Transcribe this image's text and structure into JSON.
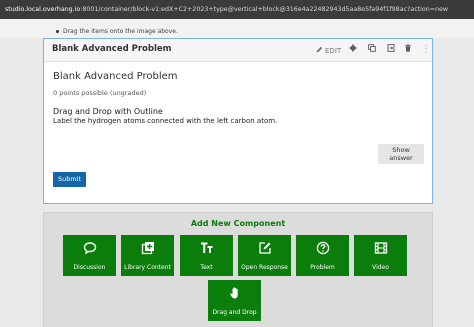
{
  "browser": {
    "url_host": "studio.local.overhang.io",
    "url_rest": ":8001/container/block-v1:edX+C2+2023+type@vertical+block@316e4a22482943d5aa8e5fa94f1f98ac?action=new"
  },
  "above_content": {
    "partial_text": "Drag the items onto the image above."
  },
  "xblock": {
    "header_title": "Blank Advanced Problem",
    "edit_label": "EDIT",
    "problem_title": "Blank Advanced Problem",
    "points": "0 points possible (ungraded)",
    "dnd_title": "Drag and Drop with Outline",
    "dnd_instructions": "Label the hydrogen atoms connected with the left carbon atom.",
    "show_answer": [
      "Show",
      "answer"
    ],
    "submit": "Submit"
  },
  "add_component": {
    "title": "Add New Component",
    "buttons": [
      {
        "label": "Discussion",
        "icon": "chat-bubble-icon"
      },
      {
        "label": "Library Content",
        "icon": "library-icon"
      },
      {
        "label": "Text",
        "icon": "text-icon"
      },
      {
        "label": "Open Response",
        "icon": "edit-square-icon"
      },
      {
        "label": "Problem",
        "icon": "question-circle-icon"
      },
      {
        "label": "Video",
        "icon": "film-icon"
      },
      {
        "label": "Drag and Drop",
        "icon": "hand-pointer-icon"
      }
    ]
  },
  "colors": {
    "green": "#0a7d0a",
    "submit_blue": "#1565a8",
    "selected_border": "#7fb3e6"
  }
}
